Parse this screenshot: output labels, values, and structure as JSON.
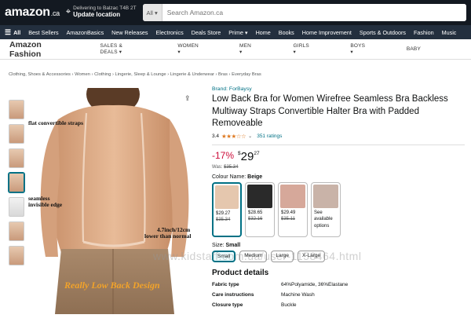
{
  "header": {
    "logo": "amazon",
    "logo_tld": ".ca",
    "deliver_line1": "Delivering to Balzac T4B 2T",
    "deliver_line2": "Update location",
    "search_category": "All",
    "search_placeholder": "Search Amazon.ca"
  },
  "subnav": {
    "all_label": "All",
    "items": [
      "Best Sellers",
      "AmazonBasics",
      "New Releases",
      "Electronics",
      "Deals Store",
      "Prime ▾",
      "Home",
      "Books",
      "Home Improvement",
      "Sports & Outdoors",
      "Fashion",
      "Music"
    ]
  },
  "fashion_nav": {
    "brand": "Amazon Fashion",
    "categories": [
      "SALES & DEALS ▾",
      "WOMEN ▾",
      "MEN ▾",
      "GIRLS ▾",
      "BOYS ▾",
      "BABY"
    ]
  },
  "breadcrumb": "Clothing, Shoes & Accessories › Women › Clothing › Lingerie, Sleep & Lounge › Lingerie & Underwear › Bras › Everyday Bras",
  "image_overlay": {
    "label1": "flat convertible straps",
    "label2a": "seamless",
    "label2b": "invisible edge",
    "label3a": "4.7inch/12cm",
    "label3b": "lower than normal",
    "caption": "Really Low Back Design"
  },
  "product": {
    "store": "Brand: ForBaysy",
    "title": "Low Back Bra for Women Wirefree Seamless Bra Backless Multiway Straps Convertible Halter Bra with Padded Removeable",
    "rating_value": "3.4",
    "stars": "★★★☆☆",
    "rating_count": "351 ratings",
    "discount": "-17%",
    "price_symbol": "$",
    "price_whole": "29",
    "price_fraction": "27",
    "was_label": "Was:",
    "was_price": "$35.34",
    "colour_label": "Colour Name:",
    "colour_value": "Beige",
    "swatches": [
      {
        "price": "$29.27",
        "orig": "$35.34",
        "color": "#e5c7ae"
      },
      {
        "price": "$28.65",
        "orig": "$32.16",
        "color": "#2a2a2a"
      },
      {
        "price": "$29.49",
        "orig": "$35.11",
        "color": "#d6a89a"
      },
      {
        "see": "See available options",
        "color": "#c9b3a8"
      }
    ],
    "size_label": "Size:",
    "size_value": "Small",
    "sizes": [
      "Small",
      "Medium",
      "Large",
      "X-Large"
    ],
    "details_heading": "Product details",
    "details": [
      {
        "k": "Fabric type",
        "v": "64%Polyamide, 36%Elastane"
      },
      {
        "k": "Care instructions",
        "v": "Machine Wash"
      },
      {
        "k": "Closure type",
        "v": "Buckle"
      }
    ]
  },
  "watermark": "www.kidstaff.com.ua/user-1158464.html"
}
